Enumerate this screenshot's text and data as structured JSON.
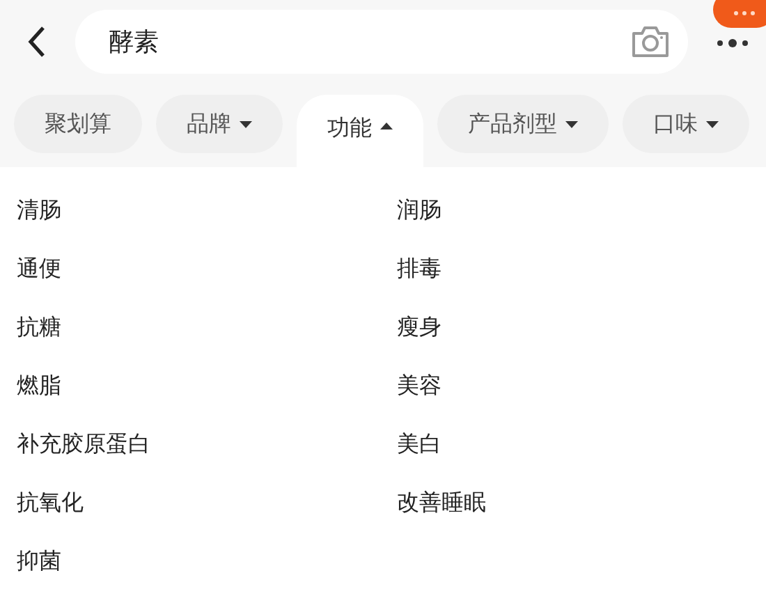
{
  "search": {
    "value": "酵素"
  },
  "filters": [
    {
      "label": "聚划算",
      "kind": "plain",
      "selected": false
    },
    {
      "label": "品牌",
      "kind": "dropdown",
      "selected": false
    },
    {
      "label": "功能",
      "kind": "dropdown",
      "selected": true
    },
    {
      "label": "产品剂型",
      "kind": "dropdown",
      "selected": false
    },
    {
      "label": "口味",
      "kind": "dropdown",
      "selected": false
    }
  ],
  "options": [
    "清肠",
    "润肠",
    "通便",
    "排毒",
    "抗糖",
    "瘦身",
    "燃脂",
    "美容",
    "补充胶原蛋白",
    "美白",
    "抗氧化",
    "改善睡眠",
    "抑菌"
  ]
}
